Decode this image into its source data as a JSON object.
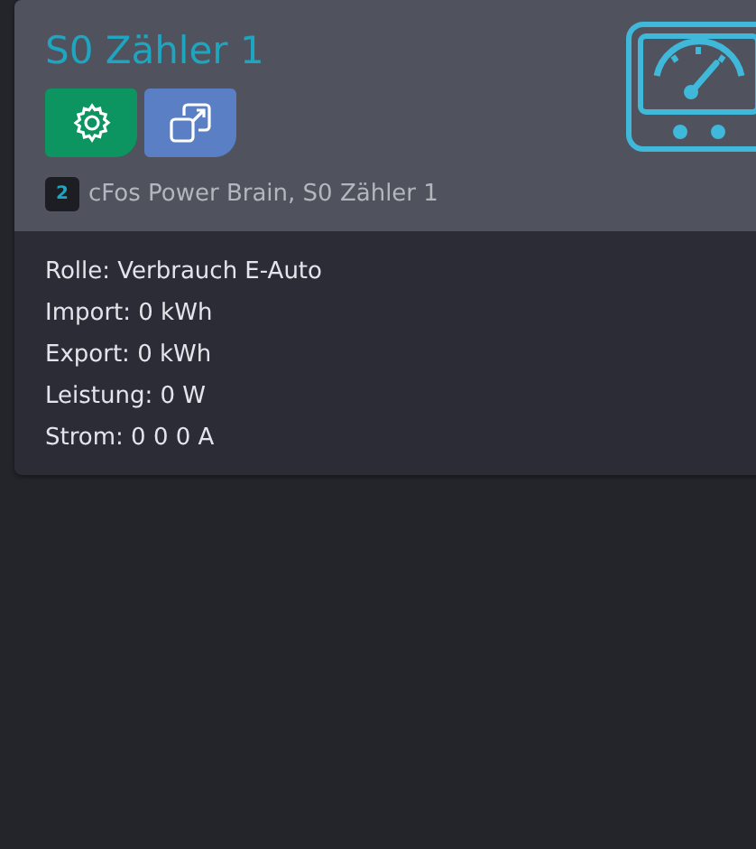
{
  "card": {
    "title": "S0 Zähler 1",
    "buttons": [
      {
        "kind": "settings"
      },
      {
        "kind": "open"
      }
    ],
    "badge": "2",
    "path": "cFos Power Brain, S0 Zähler 1",
    "details": [
      "Rolle: Verbrauch E-Auto",
      "Import: 0 kWh",
      "Export: 0 kWh",
      "Leistung: 0 W",
      "Strom: 0 0 0 A"
    ]
  }
}
